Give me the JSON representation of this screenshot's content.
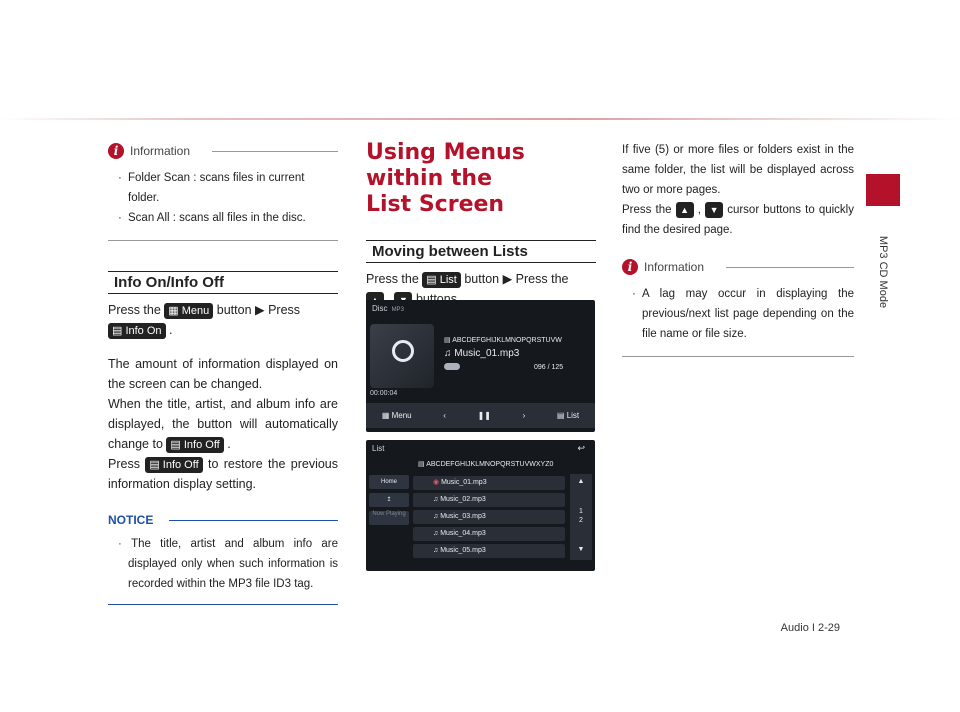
{
  "side_tab": {
    "label": "MP3 CD Mode"
  },
  "footer": {
    "text": "Audio  I  2-29"
  },
  "col1": {
    "info_title": "Information",
    "info_items": [
      "Folder Scan : scans files in current folder.",
      "Scan All : scans all files in the disc."
    ],
    "section_title": "Info On/Info Off",
    "press_the": "Press the",
    "menu_btn": "Menu",
    "button_press": "button ▶ Press",
    "info_on_btn": "Info On",
    "period": ".",
    "para1": "The amount of information displayed on the screen can be changed.",
    "para2a": "When the title, artist, and album info are displayed, the button will automatically change to",
    "info_off_btn": "Info Off",
    "para3a": "Press",
    "para3b": "to restore the previous information display setting.",
    "notice_title": "NOTICE",
    "notice_item": "The title, artist and album info are displayed only when such information is recorded within the MP3 file ID3 tag."
  },
  "col2": {
    "title_line1": "Using Menus within the",
    "title_line2": "List Screen",
    "section_title": "Moving between Lists",
    "press_the": "Press the",
    "list_btn": "List",
    "button_press_the": "button ▶ Press the",
    "comma": ",",
    "buttons": "buttons."
  },
  "col3": {
    "para1": "If five (5) or more files or folders exist in the same folder, the list will be displayed across two or more pages.",
    "para2a": "Press the",
    "para2b": "cursor buttons to quickly find the desired page.",
    "info_title": "Information",
    "info_item": "A lag may occur in displaying the previous/next list page depending on the file name or file size."
  },
  "screen1": {
    "title": "Disc",
    "mode": "MP3",
    "folder": "ABCDEFGHIJKLMNOPQRSTUVW",
    "song": "Music_01.mp3",
    "track": "096 / 125",
    "time": "00:00:04",
    "menu": "Menu",
    "list": "List"
  },
  "screen2": {
    "title": "List",
    "folder": "ABCDEFGHIJKLMNOPQRSTUVWXYZ0",
    "home": "Home",
    "now_playing": "Now Playing",
    "page_cur": "1",
    "page_total": "2",
    "files": [
      "Music_01.mp3",
      "Music_02.mp3",
      "Music_03.mp3",
      "Music_04.mp3",
      "Music_05.mp3"
    ]
  },
  "colors": {
    "accent": "#b3122a",
    "notice": "#1f4fa8"
  }
}
